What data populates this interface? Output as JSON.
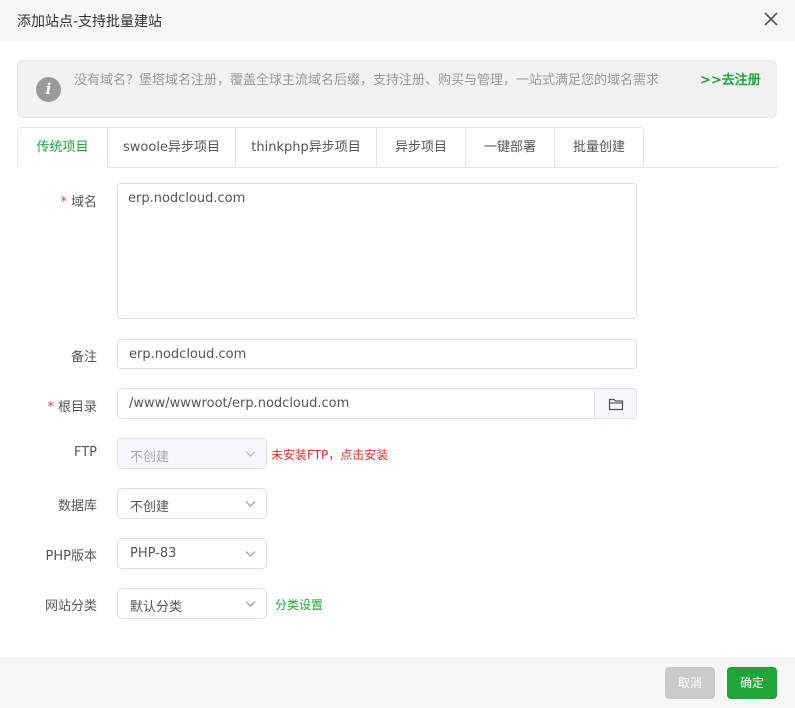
{
  "dialog": {
    "title": "添加站点-支持批量建站",
    "close_icon": "close-icon"
  },
  "notice": {
    "icon": "info-icon",
    "text": "没有域名？堡塔域名注册，覆盖全球主流域名后缀，支持注册、购买与管理，一站式满足您的域名需求",
    "link": ">>去注册"
  },
  "tabs": [
    {
      "label": "传统项目",
      "active": true
    },
    {
      "label": "swoole异步项目",
      "active": false
    },
    {
      "label": "thinkphp异步项目",
      "active": false
    },
    {
      "label": "异步项目",
      "active": false
    },
    {
      "label": "一键部署",
      "active": false
    },
    {
      "label": "批量创建",
      "active": false
    }
  ],
  "form": {
    "domain": {
      "label": "域名",
      "required_mark": "*",
      "value": "erp.nodcloud.com"
    },
    "remark": {
      "label": "备注",
      "value": "erp.nodcloud.com"
    },
    "root": {
      "label": "根目录",
      "required_mark": "*",
      "value": "/www/wwwroot/erp.nodcloud.com",
      "browse_icon": "folder-icon"
    },
    "ftp": {
      "label": "FTP",
      "value": "不创建",
      "disabled": true,
      "warning": "未安装FTP，点击安装"
    },
    "database": {
      "label": "数据库",
      "value": "不创建"
    },
    "php": {
      "label": "PHP版本",
      "value": "PHP-83"
    },
    "category": {
      "label": "网站分类",
      "value": "默认分类",
      "settings_link": "分类设置"
    }
  },
  "footer": {
    "cancel_label": "取消",
    "confirm_label": "确定"
  },
  "colors": {
    "accent": "#20a53a",
    "warning": "#e22b2b",
    "required": "#e64545"
  }
}
